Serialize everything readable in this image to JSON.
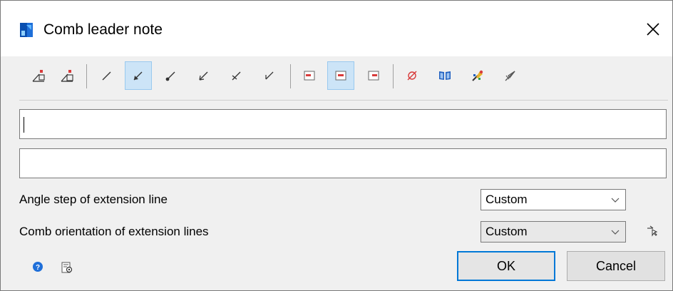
{
  "window": {
    "title": "Comb leader note",
    "app_icon": "app-logo-icon",
    "close_icon": "close-icon"
  },
  "toolbar": {
    "groups": [
      [
        "insert-leader-icon",
        "insert-leader-alt-icon"
      ],
      [
        "leader-style-1-icon",
        "leader-style-2-icon",
        "leader-style-3-icon",
        "leader-style-4-icon",
        "leader-style-5-icon",
        "leader-style-6-icon"
      ],
      [
        "text-align-left-icon",
        "text-align-center-icon",
        "text-align-right-icon"
      ],
      [
        "diameter-symbol-icon",
        "library-icon",
        "properties-icon",
        "pick-arrow-icon"
      ]
    ],
    "selected": [
      "leader-style-2-icon",
      "text-align-center-icon"
    ]
  },
  "fields": {
    "text_line_1": "",
    "text_line_2": ""
  },
  "settings": {
    "angle_step_label": "Angle step of extension line",
    "angle_step_value": "Custom",
    "comb_orientation_label": "Comb orientation of extension lines",
    "comb_orientation_value": "Custom"
  },
  "footer": {
    "help_icon": "help-icon",
    "settings_icon": "settings-icon",
    "ok_label": "OK",
    "cancel_label": "Cancel"
  },
  "colors": {
    "accent": "#0078d7",
    "selected_bg": "#cce4f7",
    "red_icon": "#d83b3b",
    "blue_icon": "#1f5fbf"
  }
}
